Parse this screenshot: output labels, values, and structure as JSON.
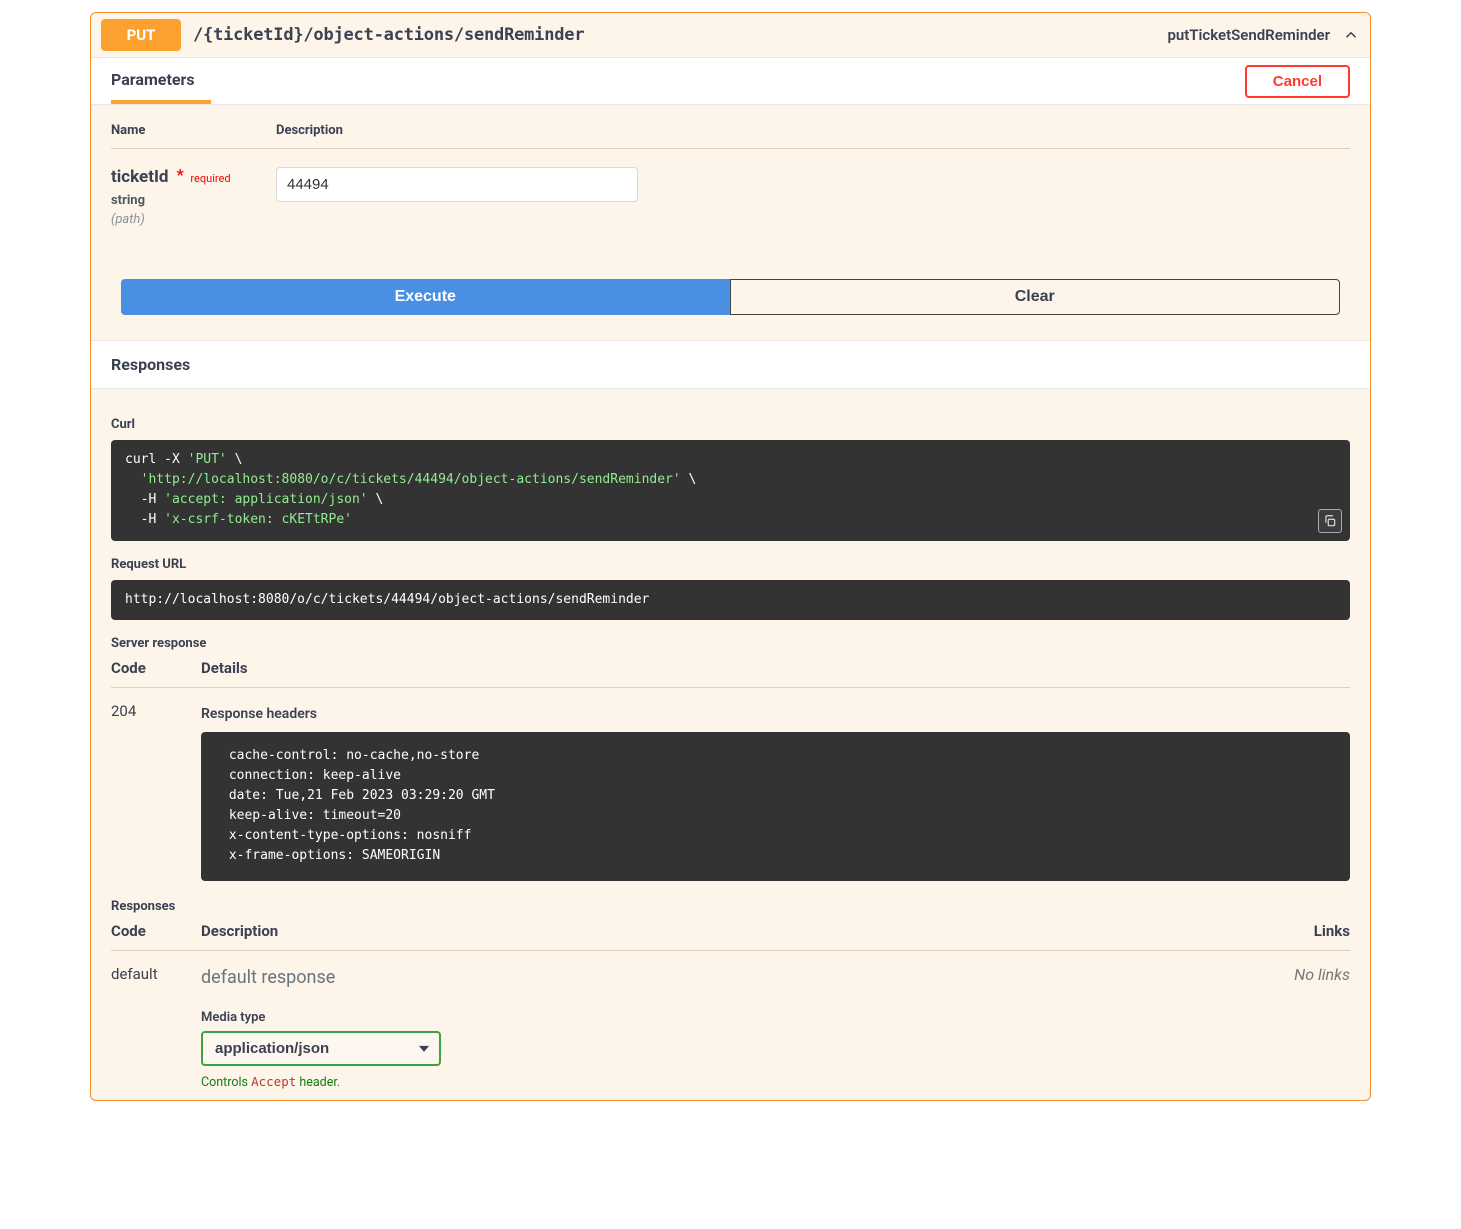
{
  "op": {
    "method": "PUT",
    "path": "/{ticketId}/object-actions/sendReminder",
    "id": "putTicketSendReminder"
  },
  "tabs": {
    "parameters": "Parameters",
    "cancel": "Cancel"
  },
  "paramTable": {
    "head_name": "Name",
    "head_desc": "Description"
  },
  "param": {
    "name": "ticketId",
    "required": "required",
    "type": "string",
    "in": "(path)",
    "value": "44494"
  },
  "actions": {
    "execute": "Execute",
    "clear": "Clear"
  },
  "responses_header": "Responses",
  "curl": {
    "label": "Curl",
    "l1a": "curl -X ",
    "l1b": "'PUT'",
    "l1c": " \\",
    "l2a": "  ",
    "l2b": "'http://localhost:8080/o/c/tickets/44494/object-actions/sendReminder'",
    "l2c": " \\",
    "l3a": "  -H ",
    "l3b": "'accept: application/json'",
    "l3c": " \\",
    "l4a": "  -H ",
    "l4b": "'x-csrf-token: cKETtRPe'"
  },
  "request_url": {
    "label": "Request URL",
    "value": "http://localhost:8080/o/c/tickets/44494/object-actions/sendReminder"
  },
  "server_response": {
    "label": "Server response",
    "code_head": "Code",
    "details_head": "Details",
    "code": "204",
    "headers_label": "Response headers",
    "headers": " cache-control: no-cache,no-store \n connection: keep-alive \n date: Tue,21 Feb 2023 03:29:20 GMT \n keep-alive: timeout=20 \n x-content-type-options: nosniff \n x-frame-options: SAMEORIGIN "
  },
  "responses": {
    "label": "Responses",
    "code_head": "Code",
    "desc_head": "Description",
    "links_head": "Links",
    "code": "default",
    "desc": "default response",
    "no_links": "No links",
    "media_label": "Media type",
    "media_value": "application/json",
    "accept_note_a": "Controls ",
    "accept_note_b": "Accept",
    "accept_note_c": " header."
  }
}
